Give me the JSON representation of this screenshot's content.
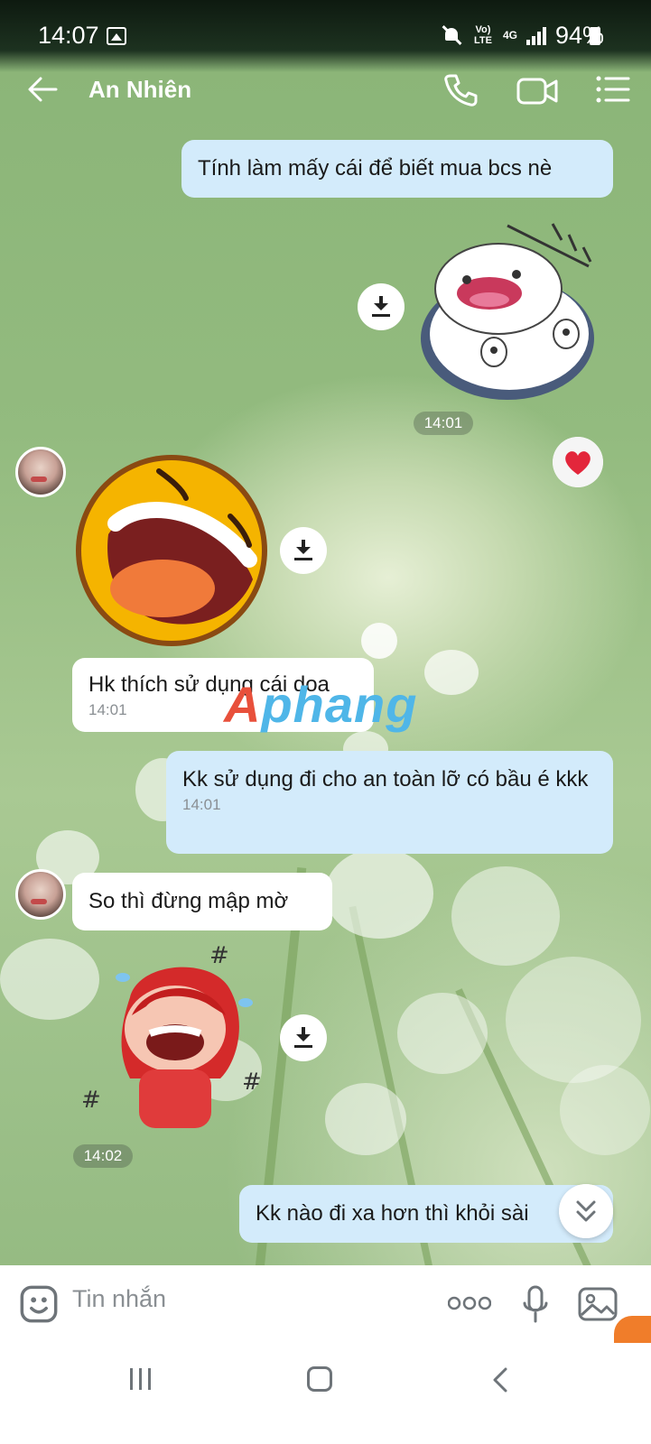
{
  "status_bar": {
    "time": "14:07",
    "network_lte": "Vo) LTE",
    "network_4g": "4G",
    "battery": "94%"
  },
  "header": {
    "title": "An Nhiên"
  },
  "messages": [
    {
      "text": "Tính làm mấy cái để biết mua bcs nè"
    },
    {
      "time": "14:01"
    },
    {
      "text": "Hk thích sử dụng cái doa",
      "time": "14:01"
    },
    {
      "text": "Kk sử dụng đi cho an toàn lỡ có bầu é kkk",
      "time": "14:01"
    },
    {
      "text": "So thì đừng mập mờ"
    },
    {
      "time": "14:02"
    },
    {
      "text": "Kk nào đi xa hơn thì khỏi sài"
    }
  ],
  "watermark": {
    "part1": "A",
    "part2": "phang"
  },
  "input": {
    "placeholder": "Tin nhắn"
  },
  "colors": {
    "outgoing_bubble": "#d3ebfb",
    "incoming_bubble": "#ffffff",
    "header_text": "#ffffff",
    "accent_badge": "#f07d2a"
  },
  "icons": {
    "header": [
      "back-arrow-icon",
      "phone-icon",
      "video-call-icon",
      "menu-list-icon"
    ],
    "input_bar": [
      "emoji-icon",
      "more-icon",
      "microphone-icon",
      "gallery-icon"
    ],
    "nav_bar": [
      "recent-apps-icon",
      "home-icon",
      "back-icon"
    ]
  }
}
